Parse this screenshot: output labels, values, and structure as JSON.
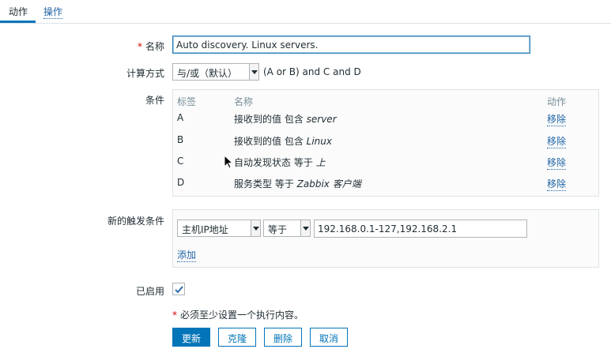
{
  "tabs": [
    {
      "label": "动作"
    },
    {
      "label": "操作"
    }
  ],
  "form": {
    "name": {
      "label": "名称",
      "required_mark": "*",
      "value": "Auto discovery. Linux servers."
    },
    "calc": {
      "label": "计算方式",
      "selected": "与/或（默认）",
      "expression": "(A or B) and C and D"
    },
    "conditions": {
      "label": "条件",
      "headers": {
        "tag": "标签",
        "name": "名称",
        "action": "动作"
      },
      "rows": [
        {
          "tag": "A",
          "text": "接收到的值 包含 ",
          "value": "server",
          "action": "移除"
        },
        {
          "tag": "B",
          "text": "接收到的值 包含 ",
          "value": "Linux",
          "action": "移除"
        },
        {
          "tag": "C",
          "text": "自动发现状态 等于 ",
          "value": "上",
          "action": "移除"
        },
        {
          "tag": "D",
          "text": "服务类型 等于 ",
          "value": "Zabbix 客户端",
          "action": "移除"
        }
      ]
    },
    "new_condition": {
      "label": "新的触发条件",
      "type": "主机IP地址",
      "operator": "等于",
      "value": "192.168.0.1-127,192.168.2.1",
      "add_label": "添加"
    },
    "enabled": {
      "label": "已启用",
      "checked": true
    },
    "note": {
      "mark": "*",
      "text": "必须至少设置一个执行内容。"
    }
  },
  "buttons": {
    "update": "更新",
    "clone": "克隆",
    "delete": "删除",
    "cancel": "取消"
  },
  "colors": {
    "accent": "#0275b8",
    "link": "#1f65a6",
    "required": "#d40000"
  }
}
